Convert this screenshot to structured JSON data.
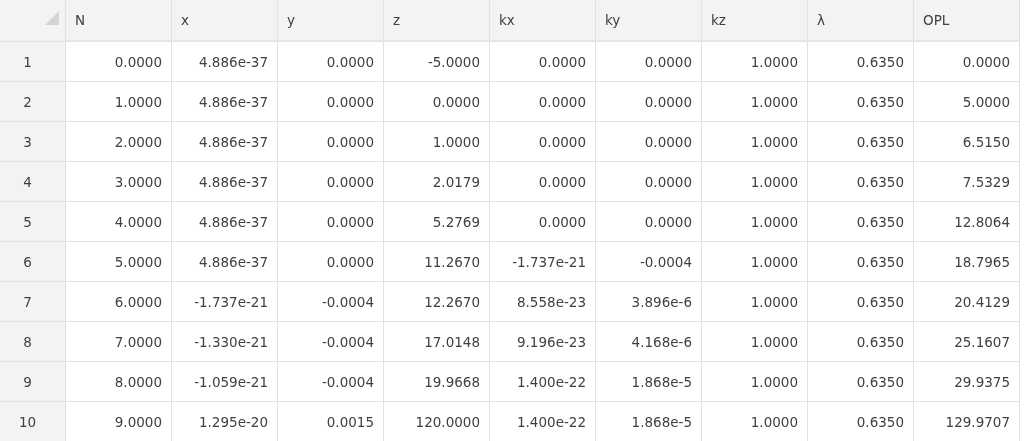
{
  "table": {
    "columns": [
      "N",
      "x",
      "y",
      "z",
      "kx",
      "ky",
      "kz",
      "λ",
      "OPL"
    ],
    "rows": [
      {
        "header": "1",
        "cells": [
          "0.0000",
          "4.886e-37",
          "0.0000",
          "-5.0000",
          "0.0000",
          "0.0000",
          "1.0000",
          "0.6350",
          "0.0000"
        ]
      },
      {
        "header": "2",
        "cells": [
          "1.0000",
          "4.886e-37",
          "0.0000",
          "0.0000",
          "0.0000",
          "0.0000",
          "1.0000",
          "0.6350",
          "5.0000"
        ]
      },
      {
        "header": "3",
        "cells": [
          "2.0000",
          "4.886e-37",
          "0.0000",
          "1.0000",
          "0.0000",
          "0.0000",
          "1.0000",
          "0.6350",
          "6.5150"
        ]
      },
      {
        "header": "4",
        "cells": [
          "3.0000",
          "4.886e-37",
          "0.0000",
          "2.0179",
          "0.0000",
          "0.0000",
          "1.0000",
          "0.6350",
          "7.5329"
        ]
      },
      {
        "header": "5",
        "cells": [
          "4.0000",
          "4.886e-37",
          "0.0000",
          "5.2769",
          "0.0000",
          "0.0000",
          "1.0000",
          "0.6350",
          "12.8064"
        ]
      },
      {
        "header": "6",
        "cells": [
          "5.0000",
          "4.886e-37",
          "0.0000",
          "11.2670",
          "-1.737e-21",
          "-0.0004",
          "1.0000",
          "0.6350",
          "18.7965"
        ]
      },
      {
        "header": "7",
        "cells": [
          "6.0000",
          "-1.737e-21",
          "-0.0004",
          "12.2670",
          "8.558e-23",
          "3.896e-6",
          "1.0000",
          "0.6350",
          "20.4129"
        ]
      },
      {
        "header": "8",
        "cells": [
          "7.0000",
          "-1.330e-21",
          "-0.0004",
          "17.0148",
          "9.196e-23",
          "4.168e-6",
          "1.0000",
          "0.6350",
          "25.1607"
        ]
      },
      {
        "header": "9",
        "cells": [
          "8.0000",
          "-1.059e-21",
          "-0.0004",
          "19.9668",
          "1.400e-22",
          "1.868e-5",
          "1.0000",
          "0.6350",
          "29.9375"
        ]
      },
      {
        "header": "10",
        "cells": [
          "9.0000",
          "1.295e-20",
          "0.0015",
          "120.0000",
          "1.400e-22",
          "1.868e-5",
          "1.0000",
          "0.6350",
          "129.9707"
        ]
      }
    ]
  }
}
